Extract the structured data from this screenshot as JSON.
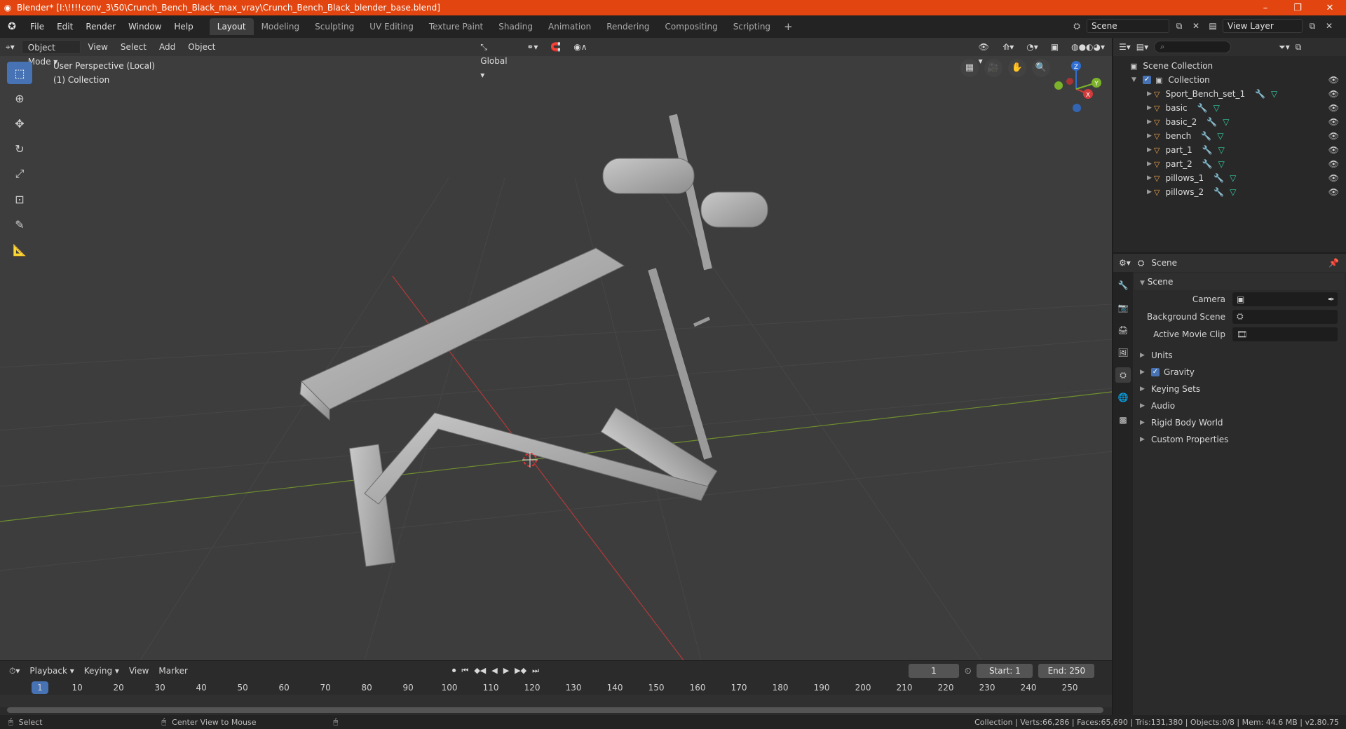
{
  "titlebar": {
    "title": "Blender* [I:\\!!!!conv_3\\50\\Crunch_Bench_Black_max_vray\\Crunch_Bench_Black_blender_base.blend]",
    "minimize": "–",
    "maximize": "❐",
    "close": "✕"
  },
  "menubar": {
    "items": [
      "File",
      "Edit",
      "Render",
      "Window",
      "Help"
    ],
    "workspaces": [
      "Layout",
      "Modeling",
      "Sculpting",
      "UV Editing",
      "Texture Paint",
      "Shading",
      "Animation",
      "Rendering",
      "Compositing",
      "Scripting"
    ],
    "add_workspace": "+",
    "scene_name": "Scene",
    "view_layer": "View Layer"
  },
  "viewport": {
    "mode": "Object Mode",
    "menus": [
      "View",
      "Select",
      "Add",
      "Object"
    ],
    "transform_orientation": "Global",
    "perspective_label": "User Perspective (Local)",
    "collection_label": "(1) Collection",
    "gizmo_axes": {
      "x": "X",
      "y": "Y",
      "z": "Z"
    },
    "colors": {
      "background": "#3d3d3d",
      "x_axis": "#b33a3a",
      "y_axis": "#6f8f2e",
      "mesh": "#b4b4b4"
    }
  },
  "timeline": {
    "menus": [
      "Playback",
      "Keying",
      "View",
      "Marker"
    ],
    "current_frame": "1",
    "start_label": "Start:",
    "start_value": "1",
    "end_label": "End:",
    "end_value": "250",
    "ruler": [
      "1",
      "10",
      "20",
      "30",
      "40",
      "50",
      "60",
      "70",
      "80",
      "90",
      "100",
      "110",
      "120",
      "130",
      "140",
      "150",
      "160",
      "170",
      "180",
      "190",
      "200",
      "210",
      "220",
      "230",
      "240",
      "250"
    ]
  },
  "statusbar": {
    "select": "Select",
    "center_view": "Center View to Mouse",
    "stats": "Collection | Verts:66,286 | Faces:65,690 | Tris:131,380 | Objects:0/8 | Mem: 44.6 MB | v2.80.75"
  },
  "outliner": {
    "search_placeholder": "⌕",
    "scene_collection": "Scene Collection",
    "collection": "Collection",
    "objects": [
      "Sport_Bench_set_1",
      "basic",
      "basic_2",
      "bench",
      "part_1",
      "part_2",
      "pillows_1",
      "pillows_2"
    ]
  },
  "properties": {
    "header": "Scene",
    "panel": "Scene",
    "camera_label": "Camera",
    "background_scene_label": "Background Scene",
    "active_movie_clip_label": "Active Movie Clip",
    "subpanels": [
      "Units",
      "Gravity",
      "Keying Sets",
      "Audio",
      "Rigid Body World",
      "Custom Properties"
    ],
    "gravity_checked": true
  }
}
